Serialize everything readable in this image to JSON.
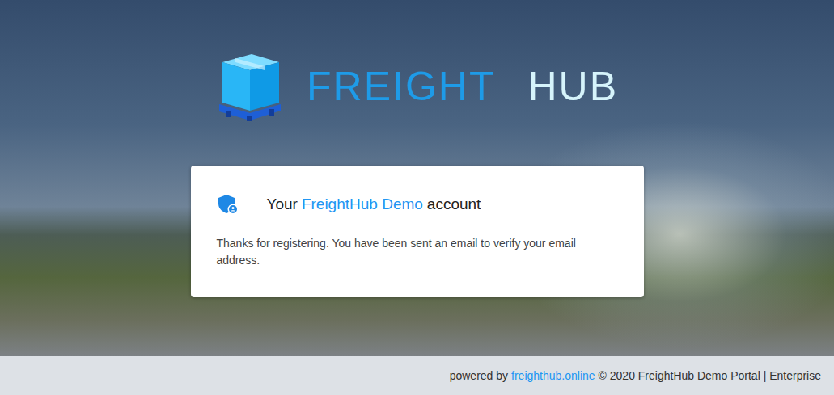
{
  "logo": {
    "word1": "FREIGHT",
    "word2": "HUB"
  },
  "card": {
    "title_prefix": "Your",
    "title_brand": "FreightHub Demo",
    "title_suffix": "account",
    "message": "Thanks for registering. You have been sent an email to verify your email address."
  },
  "footer": {
    "prefix": "powered by",
    "link": "freighthub.online",
    "suffix": "© 2020 FreightHub Demo Portal | Enterprise"
  }
}
